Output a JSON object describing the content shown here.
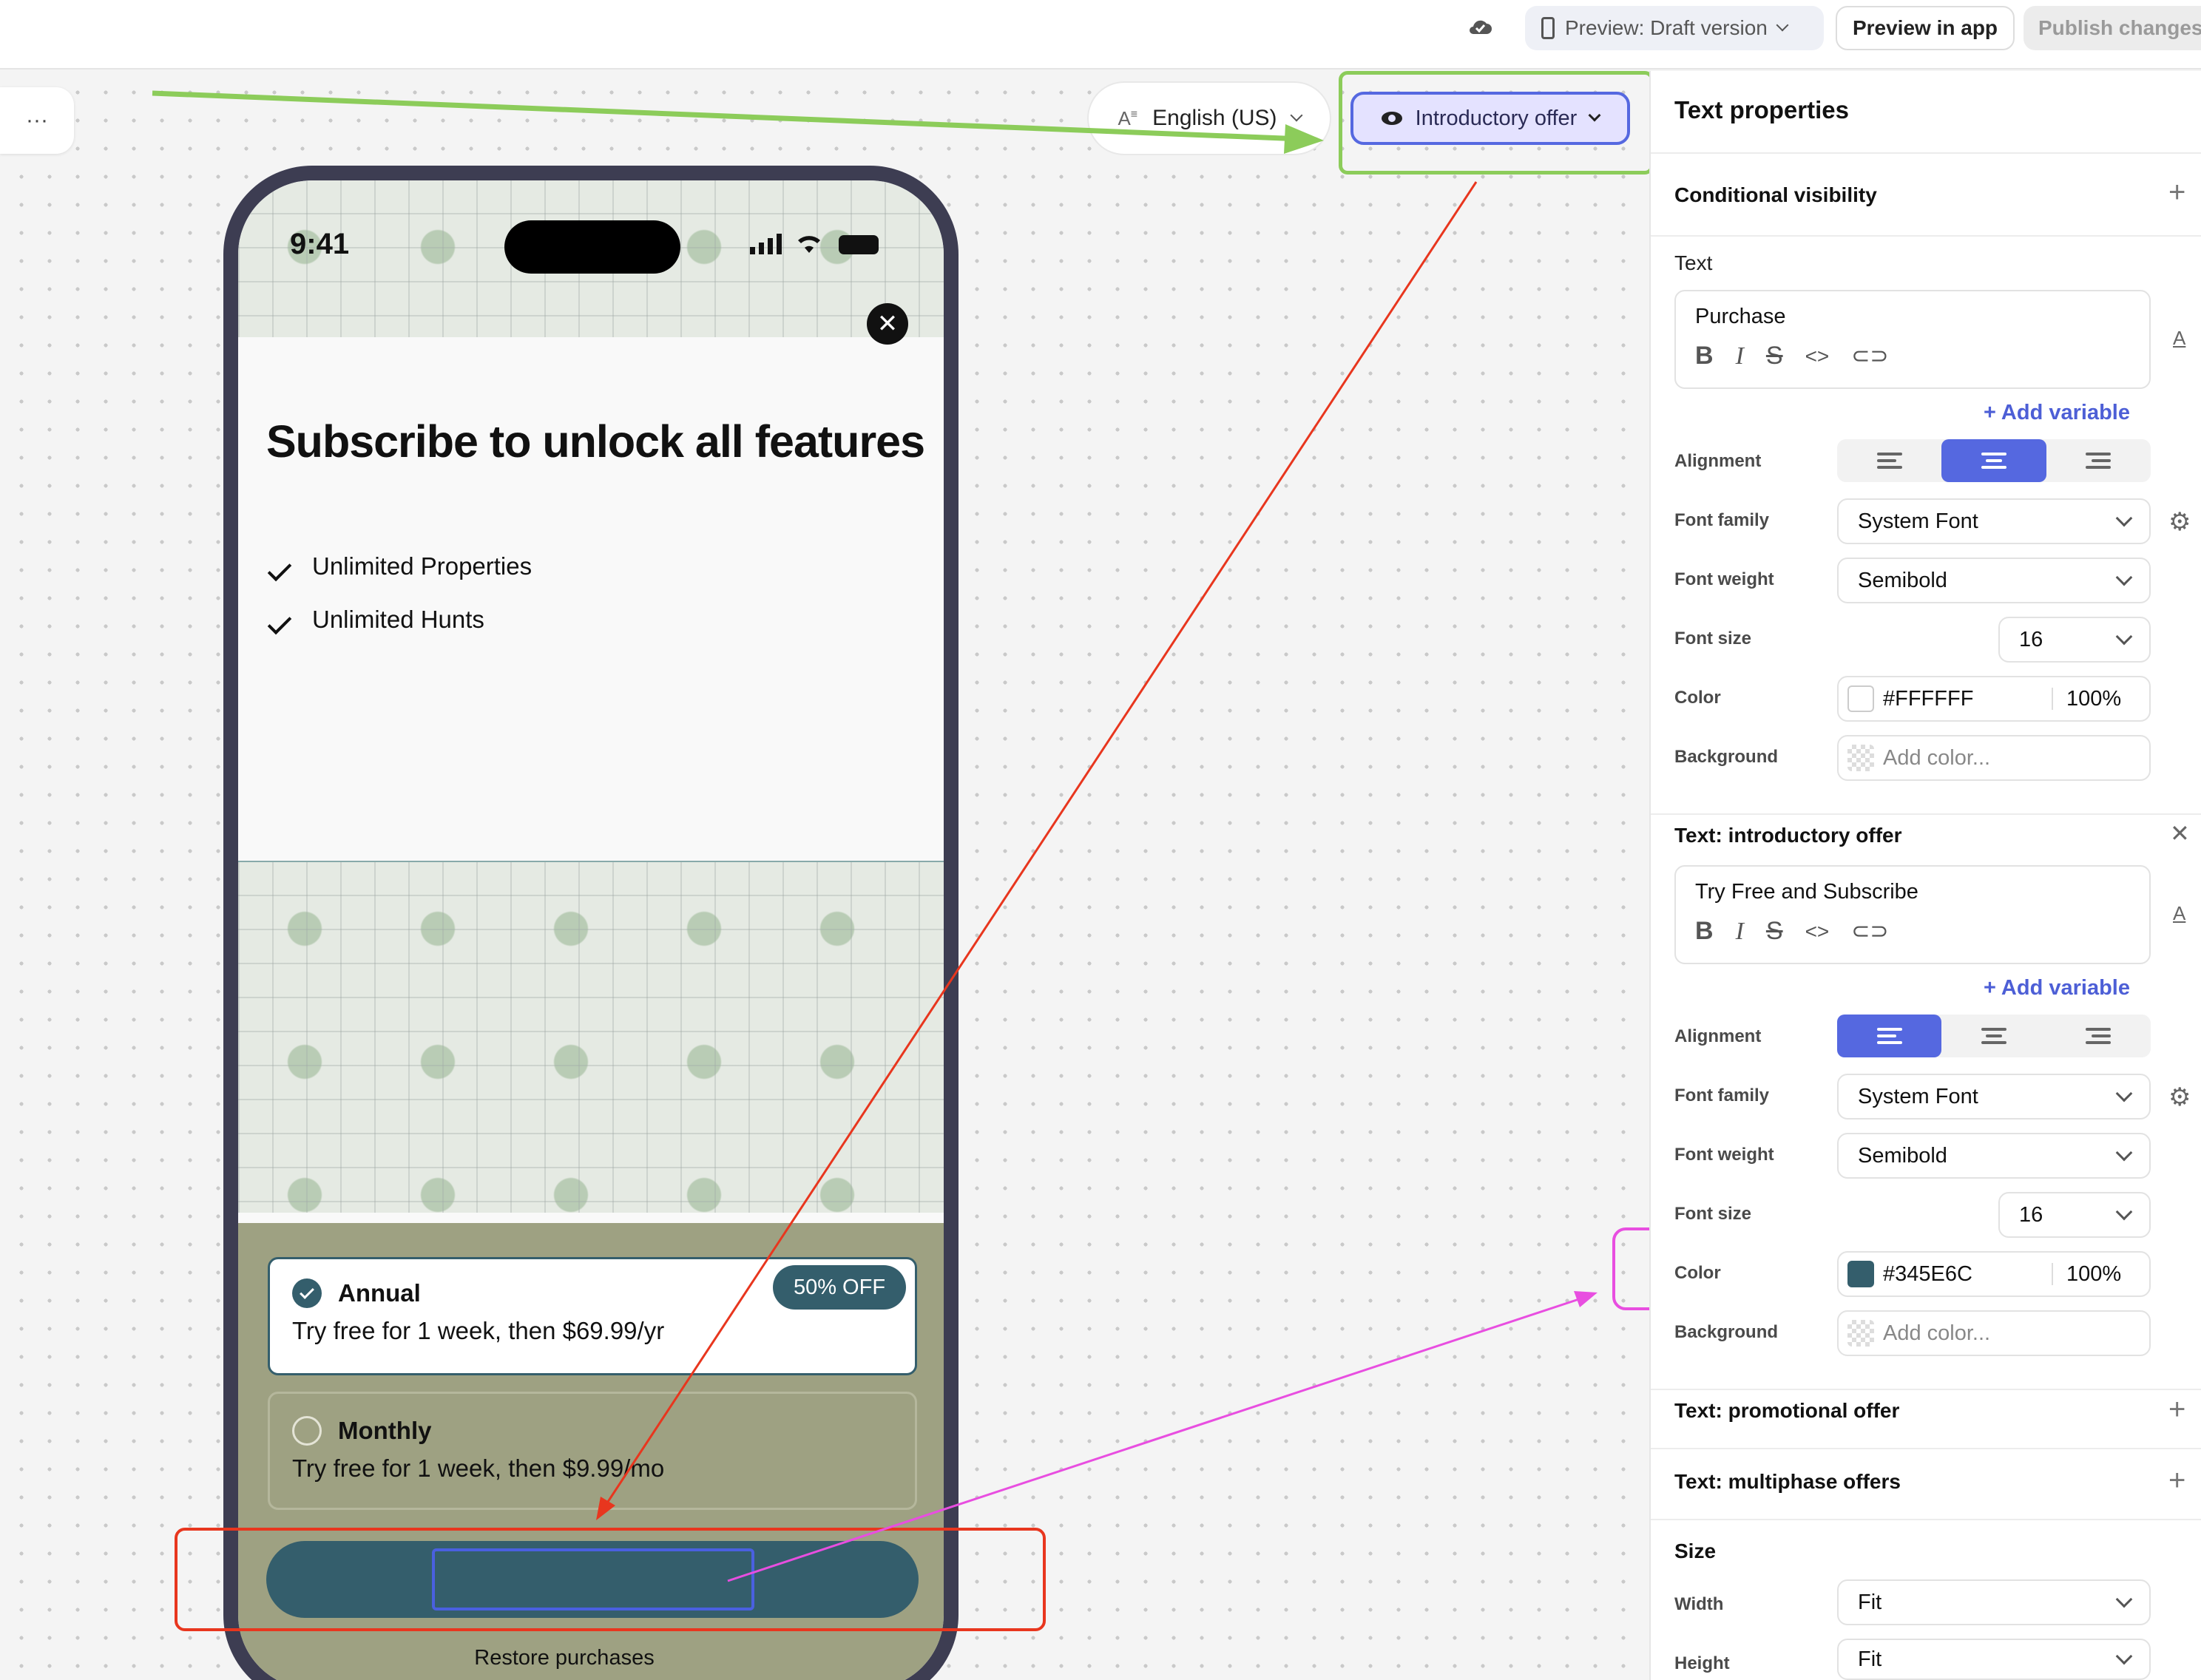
{
  "topbar": {
    "cloud_icon": "cloud-icon",
    "preview_label": "Preview: Draft version",
    "preview_in_app": "Preview in app",
    "publish": "Publish changes"
  },
  "canvas": {
    "more_menu": "···",
    "language": "English (US)",
    "visibility_mode": "Introductory offer"
  },
  "phone": {
    "time": "9:41",
    "headline": "Subscribe to unlock all features",
    "features": [
      "Unlimited Properties",
      "Unlimited Hunts"
    ],
    "plans": [
      {
        "name": "Annual",
        "desc": "Try free for 1 week, then $69.99/yr",
        "badge": "50% OFF",
        "selected": true
      },
      {
        "name": "Monthly",
        "desc": "Try free for 1 week, then $9.99/mo",
        "badge": "",
        "selected": false
      }
    ],
    "restore": "Restore purchases"
  },
  "panel": {
    "title": "Text properties",
    "conditional_visibility": "Conditional visibility",
    "text_label": "Text",
    "text_value": "Purchase",
    "add_variable": "Add variable",
    "alignment": "Alignment",
    "font_family": "Font family",
    "font_family_value": "System Font",
    "font_weight": "Font weight",
    "font_weight_value": "Semibold",
    "font_size": "Font size",
    "font_size_value": "16",
    "color": "Color",
    "color_hex": "#FFFFFF",
    "color_opacity": "100%",
    "background": "Background",
    "add_color": "Add color...",
    "intro_section": "Text: introductory offer",
    "intro_text_value": "Try Free and Subscribe",
    "intro_color_hex": "#345E6C",
    "intro_color_opacity": "100%",
    "promo_section": "Text: promotional offer",
    "multiphase_section": "Text: multiphase offers",
    "size_section": "Size",
    "width": "Width",
    "width_value": "Fit",
    "height": "Height",
    "height_value": "Fit"
  },
  "colors": {
    "accent": "#5568e0",
    "brand_teal": "#345E6C",
    "plan_area": "#9ea182",
    "annotation_green": "#8ccc5a",
    "annotation_red": "#e8361e",
    "annotation_magenta": "#e84ee0"
  }
}
